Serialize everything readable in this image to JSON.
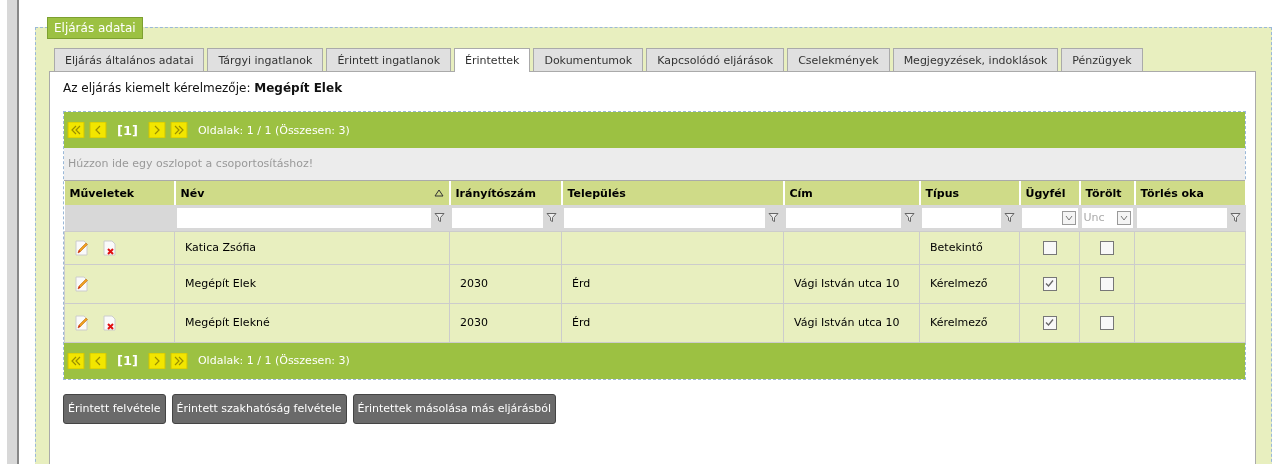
{
  "section": {
    "legend": "Eljárás adatai"
  },
  "tabs": [
    {
      "label": "Eljárás általános adatai",
      "selected": false
    },
    {
      "label": "Tárgyi ingatlanok",
      "selected": false
    },
    {
      "label": "Érintett ingatlanok",
      "selected": false
    },
    {
      "label": "Érintettek",
      "selected": true
    },
    {
      "label": "Dokumentumok",
      "selected": false
    },
    {
      "label": "Kapcsolódó eljárások",
      "selected": false
    },
    {
      "label": "Cselekmények",
      "selected": false
    },
    {
      "label": "Megjegyzések, indoklások",
      "selected": false
    },
    {
      "label": "Pénzügyek",
      "selected": false
    }
  ],
  "applicant_line": "Az eljárás kiemelt kérelmezője: **Megépít Elek**",
  "pager_top": {
    "current_page": "[1]",
    "info": "Oldalak: 1 / 1 (Összesen: 3)"
  },
  "group_hint": "Húzzon ide egy oszlopot a csoportosításhoz!",
  "columns": [
    {
      "label": "Műveletek",
      "sorted": false
    },
    {
      "label": "Név",
      "sorted": true
    },
    {
      "label": "Irányítószám",
      "sorted": false
    },
    {
      "label": "Település",
      "sorted": false
    },
    {
      "label": "Cím",
      "sorted": false
    },
    {
      "label": "Típus",
      "sorted": false
    },
    {
      "label": "Ügyfél",
      "sorted": false
    },
    {
      "label": "Törölt",
      "sorted": false
    },
    {
      "label": "Törlés oka",
      "sorted": false
    }
  ],
  "filters": [
    {
      "kind": "blank"
    },
    {
      "kind": "text"
    },
    {
      "kind": "text"
    },
    {
      "kind": "text"
    },
    {
      "kind": "text"
    },
    {
      "kind": "text"
    },
    {
      "kind": "select"
    },
    {
      "kind": "select",
      "value": "Unc"
    },
    {
      "kind": "text"
    }
  ],
  "rows": [
    {
      "deletable": true,
      "name": "Katica Zsófia",
      "type": "Betekintő",
      "client": false,
      "deleted": false
    },
    {
      "deletable": false,
      "name": "Megépít Elek",
      "zip": "2030",
      "city": "Érd",
      "address": "Vági István utca 10",
      "type": "Kérelmező",
      "client": true,
      "deleted": false
    },
    {
      "deletable": true,
      "name": "Megépít Elekné",
      "zip": "2030",
      "city": "Érd",
      "address": "Vági István utca 10",
      "type": "Kérelmező",
      "client": true,
      "deleted": false
    }
  ],
  "pager_bottom": {
    "current_page": "[1]",
    "info": "Oldalak: 1 / 1 (Összesen: 3)"
  },
  "buttons": [
    "Érintett felvétele",
    "Érintett szakhatóság felvétele",
    "Érintettek másolása más eljárásból"
  ]
}
